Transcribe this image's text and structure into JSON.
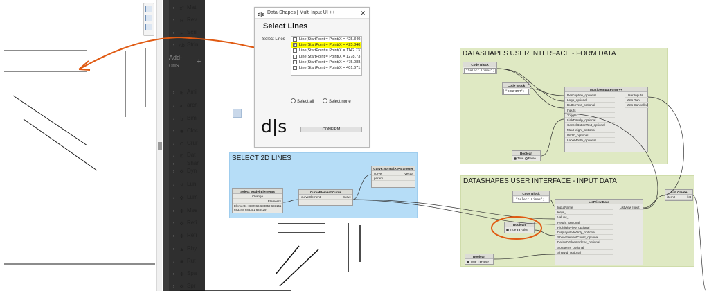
{
  "library": {
    "items": [
      {
        "label": "Mat",
        "icon": "x²"
      },
      {
        "label": "Rev",
        "icon": "R"
      },
      {
        "label": "Scri",
        "icon": "▸"
      },
      {
        "label": "Strin",
        "icon": "Ab"
      },
      {
        "label": "Ami",
        "icon": "⊞"
      },
      {
        "label": "arch",
        "icon": "a!"
      },
      {
        "label": "Bim",
        "icon": "b"
      },
      {
        "label": "Cloc",
        "icon": "✺"
      },
      {
        "label": "Crur",
        "icon": "C"
      },
      {
        "label": "Dat",
        "icon": "⊡"
      },
      {
        "label": "Shar",
        "icon": ""
      },
      {
        "label": "Dyn",
        "icon": "✜"
      },
      {
        "label": "Lun",
        "icon": "↯"
      },
      {
        "label": "Lum",
        "icon": "✜"
      },
      {
        "label": "Mes",
        "icon": "✜"
      },
      {
        "label": "Refi",
        "icon": "✜"
      },
      {
        "label": "Refi",
        "icon": "✜"
      },
      {
        "label": "Rhy",
        "icon": "▲"
      },
      {
        "label": "Rut",
        "icon": "✺"
      },
      {
        "label": "Spa",
        "icon": "✜"
      },
      {
        "label": "Spr",
        "icon": "✜"
      }
    ],
    "addons_label": "Add-\nons",
    "addons_plus": "+"
  },
  "ds_window": {
    "title": "Data-Shapes | Multi Input UI ++",
    "close": "✕",
    "heading": "Select Lines",
    "select_label": "Select Lines",
    "items": [
      {
        "text": "Line(StartPoint = Point(X = 425.340, Y",
        "checked": false
      },
      {
        "text": "Line(StartPoint = Point(X = 425.340, Y",
        "checked": true
      },
      {
        "text": "Line(StartPoint = Point(X = 1142.737,",
        "checked": false
      },
      {
        "text": "Line(StartPoint = Point(X = 1278.737,",
        "checked": false
      },
      {
        "text": "Line(StartPoint = Point(X = 475.088, Y",
        "checked": false
      },
      {
        "text": "Line(StartPoint = Point(X = 401.671, Y",
        "checked": false
      }
    ],
    "select_all": "Select all",
    "select_none": "Select none",
    "logo": "d|s",
    "confirm": "CONFIRM"
  },
  "groups": {
    "form": "DATASHAPES USER INTERFACE - FORM DATA",
    "input": "DATASHAPES USER INTERFACE - INPUT DATA",
    "select": "SELECT 2D LINES"
  },
  "nodes": {
    "code1": {
      "title": "Code Block",
      "code": "\"Select Lines\";"
    },
    "code2": {
      "title": "Code Block",
      "code": "\"CONFIRM\";"
    },
    "form": {
      "title": "MultipleInputForm ++",
      "inputs": [
        "Description_optional",
        "Logo_optional",
        "ButtonText_optional",
        "Inputs",
        "Toggle",
        "LinkToHelp_optional",
        "CancelButtonText_optional",
        "MaxHeight_optional",
        "Width_optional",
        "LabelWidth_optional"
      ],
      "outputs": [
        "User Inputs",
        "Was Run",
        "Was Cancelled"
      ]
    },
    "bool1": {
      "title": "Boolean",
      "true_label": "True",
      "false_label": "False"
    },
    "select_model": {
      "title": "Select Model Elements",
      "button": "Change",
      "output": "Elements",
      "info": "Elements : 682966 683059 683151\n683248 683351 683429"
    },
    "curve": {
      "title": "CurveElement.Curve",
      "input": "curveElement",
      "output": "Curve"
    },
    "normal": {
      "title": "Curve.NormalAtParameter",
      "inputs": [
        "curve",
        "param"
      ],
      "output": "Vector"
    },
    "code3": {
      "title": "Code Block",
      "code": "\"Select Lines\";"
    },
    "listview": {
      "title": "ListView Data",
      "inputs": [
        "InputName",
        "Keys_",
        "Values_",
        "Height_optional",
        "HighlightView_optional",
        "DisplayModeOnly_optional",
        "ShowElementCount_optional",
        "DefaultValuesIndices_optional",
        "SortItems_optional",
        "ShowId_optional"
      ],
      "output": "ListView Input"
    },
    "bool2": {
      "title": "Boolean",
      "true_label": "True",
      "false_label": "False"
    },
    "bool3": {
      "title": "Boolean",
      "true_label": "True",
      "false_label": "False"
    },
    "listcreate": {
      "title": "List.Create",
      "input": "item0",
      "output": "list"
    }
  },
  "colors": {
    "annotation": "#e05a12",
    "form_group": "#dfe9c3",
    "select_group": "#b6ddf7",
    "highlight": "#ffff00"
  }
}
